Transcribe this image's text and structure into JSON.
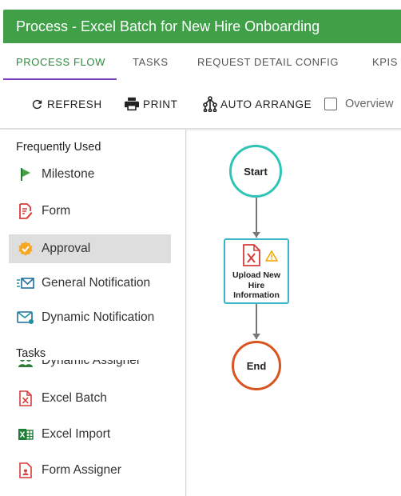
{
  "window": {
    "title": "Process - Excel Batch for New Hire Onboarding"
  },
  "tabs": [
    {
      "label": "PROCESS FLOW",
      "active": true
    },
    {
      "label": "TASKS",
      "active": false
    },
    {
      "label": "REQUEST DETAIL CONFIG",
      "active": false
    },
    {
      "label": "KPIS",
      "active": false
    }
  ],
  "toolbar": {
    "refresh_label": "REFRESH",
    "print_label": "PRINT",
    "auto_arrange_label": "AUTO ARRANGE",
    "overview_label": "Overview",
    "overview_checked": false
  },
  "palette": {
    "frequently_used_title": "Frequently Used",
    "frequently_used": [
      {
        "label": "Milestone",
        "icon": "flag-icon"
      },
      {
        "label": "Form",
        "icon": "form-edit-icon"
      },
      {
        "label": "Approval",
        "icon": "approval-check-icon",
        "selected": true
      },
      {
        "label": "General Notification",
        "icon": "general-notification-icon"
      },
      {
        "label": "Dynamic Notification",
        "icon": "dynamic-notification-icon"
      }
    ],
    "tasks_title": "Tasks",
    "tasks": [
      {
        "label": "Dynamic Assigner",
        "icon": "dynamic-assigner-icon"
      },
      {
        "label": "Excel Batch",
        "icon": "excel-batch-icon"
      },
      {
        "label": "Excel Import",
        "icon": "excel-import-icon"
      },
      {
        "label": "Form Assigner",
        "icon": "form-assigner-icon"
      }
    ]
  },
  "flow": {
    "start_label": "Start",
    "task_label": "Upload New Hire Information",
    "task_label_lines": [
      "Upload New",
      "Hire",
      "Information"
    ],
    "end_label": "End"
  },
  "colors": {
    "title_bar": "#3fa048",
    "active_tab_text": "#2e8b3d",
    "tab_underline": "#7b3fbf",
    "start_node": "#2ec4b6",
    "end_node": "#d9541e",
    "task_border": "#36b6c8",
    "warning": "#f0a500"
  }
}
